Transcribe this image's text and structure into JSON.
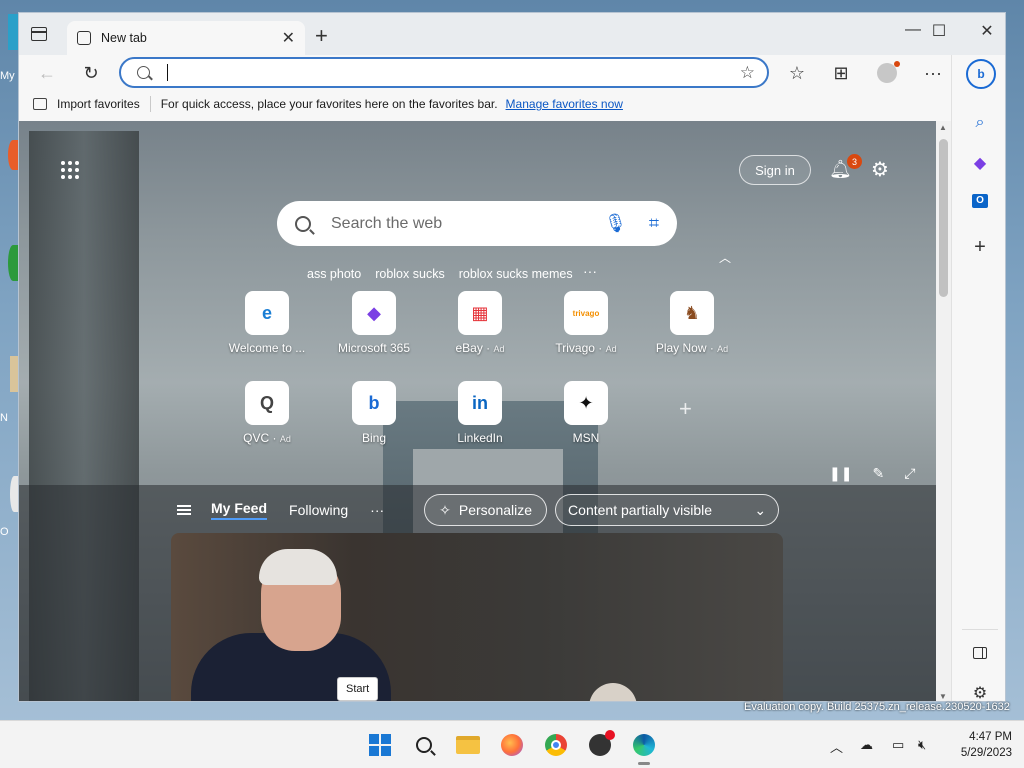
{
  "desktop": {
    "labels": [
      "My",
      "N",
      "O"
    ]
  },
  "browser": {
    "tab": {
      "title": "New tab"
    },
    "window_controls": {
      "minimize": "—",
      "maximize": "☐",
      "close": "✕"
    },
    "toolbar": {
      "back": "←",
      "refresh": "↻",
      "address_value": "",
      "favorites": "☆",
      "collections": "⊞",
      "menu": "···"
    },
    "favbar": {
      "import": "Import favorites",
      "hint": "For quick access, place your favorites here on the favorites bar.",
      "manage": "Manage favorites now"
    }
  },
  "newtab": {
    "signin": "Sign in",
    "notifications": "3",
    "search_placeholder": "Search the web",
    "suggestions": [
      "ass photo",
      "roblox sucks",
      "roblox sucks memes"
    ],
    "tiles": [
      {
        "label": "Welcome to ...",
        "ad": "",
        "icon": "edge-icon",
        "glyph": "e",
        "color": "#1a7ed4"
      },
      {
        "label": "Microsoft 365",
        "ad": "",
        "icon": "m365-icon",
        "glyph": "◆",
        "color": "#7b3fe4"
      },
      {
        "label": "eBay",
        "ad": "Ad",
        "icon": "ebay-icon",
        "glyph": "▦",
        "color": "#e53238"
      },
      {
        "label": "Trivago",
        "ad": "Ad",
        "icon": "trivago-icon",
        "glyph": "trivago",
        "color": "#f48f00"
      },
      {
        "label": "Play Now",
        "ad": "Ad",
        "icon": "game-icon",
        "glyph": "♞",
        "color": "#8a4b1f"
      },
      {
        "label": "QVC",
        "ad": "Ad",
        "icon": "qvc-icon",
        "glyph": "Q",
        "color": "#444444"
      },
      {
        "label": "Bing",
        "ad": "",
        "icon": "bing-icon",
        "glyph": "b",
        "color": "#1a6ad4"
      },
      {
        "label": "LinkedIn",
        "ad": "",
        "icon": "linkedin-icon",
        "glyph": "in",
        "color": "#0a66c2"
      },
      {
        "label": "MSN",
        "ad": "",
        "icon": "msn-icon",
        "glyph": "✦",
        "color": "#111111"
      }
    ],
    "feed": {
      "tab_myfeed": "My Feed",
      "tab_following": "Following",
      "more": "···",
      "personalize": "Personalize",
      "content_visibility": "Content partially visible"
    }
  },
  "tooltip": {
    "start": "Start"
  },
  "watermark": "Evaluation copy. Build 25375.zn_release.230520-1632",
  "taskbar": {
    "time": "4:47 PM",
    "date": "5/29/2023"
  },
  "colors": {
    "accent": "#1a6ad4",
    "badge": "#d9480f"
  }
}
